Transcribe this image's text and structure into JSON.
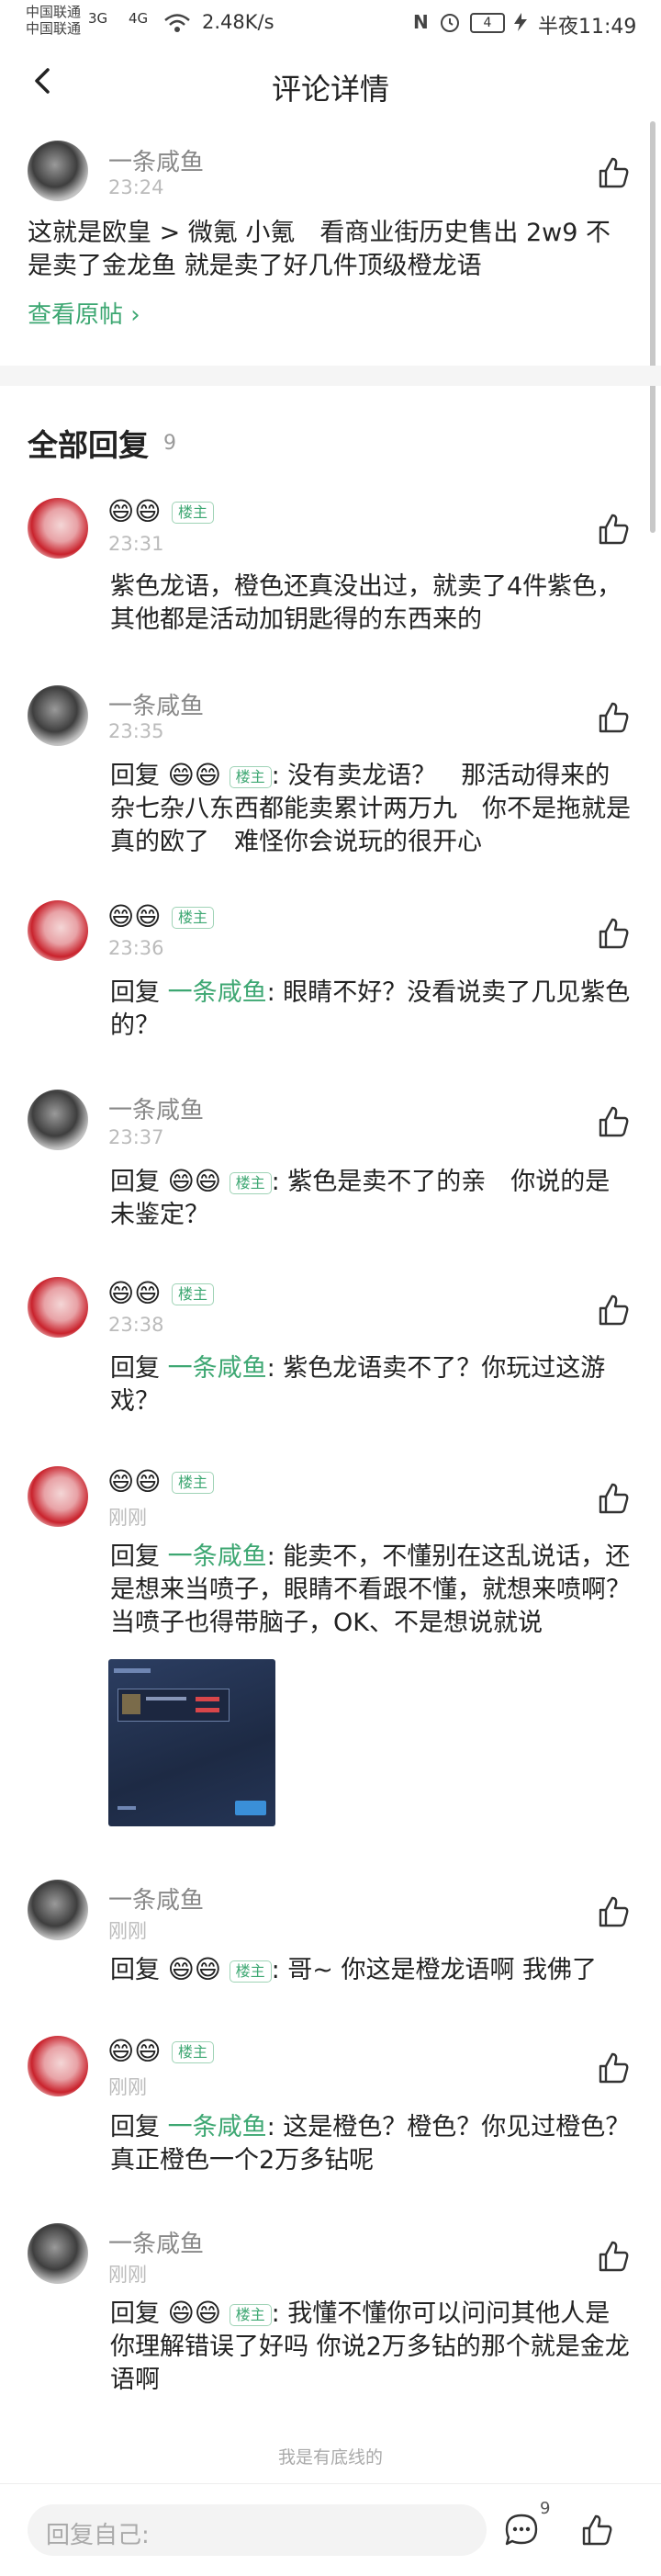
{
  "status_bar": {
    "carrier_1": "中国联通",
    "carrier_2": "中国联通",
    "signal_1": "3G",
    "signal_2": "4G",
    "speed": "2.48K/s",
    "battery": "4",
    "time": "半夜11:49"
  },
  "header": {
    "title": "评论详情"
  },
  "main_comment": {
    "author": "一条咸鱼",
    "time": "23:24",
    "text": "这就是欧皇 > 微氪 小氪　看商业街历史售出 2w9 不是卖了金龙鱼 就是卖了好几件顶级橙龙语",
    "view_original": "查看原帖 ›"
  },
  "replies_header": {
    "title": "全部回复",
    "count": "9"
  },
  "replies": [
    {
      "author_emoji": "😄😄",
      "badge": "楼主",
      "time": "23:31",
      "text": "紫色龙语，橙色还真没出过，就卖了4件紫色，其他都是活动加钥匙得的东西来的"
    },
    {
      "author": "一条咸鱼",
      "time": "23:35",
      "reply_prefix": "回复",
      "reply_to_emoji": "😄😄",
      "reply_to_badge": "楼主",
      "text": ": 没有卖龙语？　那活动得来的杂七杂八东西都能卖累计两万九　你不是拖就是真的欧了　难怪你会说玩的很开心"
    },
    {
      "author_emoji": "😄😄",
      "badge": "楼主",
      "time": "23:36",
      "reply_prefix": "回复",
      "reply_to": "一条咸鱼",
      "text": ": 眼睛不好？没看说卖了几见紫色的？"
    },
    {
      "author": "一条咸鱼",
      "time": "23:37",
      "reply_prefix": "回复",
      "reply_to_emoji": "😄😄",
      "reply_to_badge": "楼主",
      "text": ": 紫色是卖不了的亲　你说的是未鉴定？"
    },
    {
      "author_emoji": "😄😄",
      "badge": "楼主",
      "time": "23:38",
      "reply_prefix": "回复",
      "reply_to": "一条咸鱼",
      "text": ": 紫色龙语卖不了？你玩过这游戏？"
    },
    {
      "author_emoji": "😄😄",
      "badge": "楼主",
      "time": "刚刚",
      "reply_prefix": "回复",
      "reply_to": "一条咸鱼",
      "text": ": 能卖不，不懂别在这乱说话，还是想来当喷子，眼睛不看跟不懂，就想来喷啊？当喷子也得带脑子，OK、不是想说就说",
      "image": "game-screenshot"
    },
    {
      "author": "一条咸鱼",
      "time": "刚刚",
      "reply_prefix": "回复",
      "reply_to_emoji": "😄😄",
      "reply_to_badge": "楼主",
      "text": ": 哥~ 你这是橙龙语啊 我佛了"
    },
    {
      "author_emoji": "😄😄",
      "badge": "楼主",
      "time": "刚刚",
      "reply_prefix": "回复",
      "reply_to": "一条咸鱼",
      "text": ": 这是橙色？橙色？你见过橙色？真正橙色一个2万多钻呢"
    },
    {
      "author": "一条咸鱼",
      "time": "刚刚",
      "reply_prefix": "回复",
      "reply_to_emoji": "😄😄",
      "reply_to_badge": "楼主",
      "text": ": 我懂不懂你可以问问其他人是你理解错误了好吗 你说2万多钻的那个就是金龙语啊"
    }
  ],
  "footer_note": "我是有底线的",
  "bottom_bar": {
    "placeholder": "回复自己:",
    "comment_count": "9"
  },
  "colors": {
    "accent_green": "#3da772",
    "text_dark": "#222222",
    "text_gray": "#888888"
  }
}
